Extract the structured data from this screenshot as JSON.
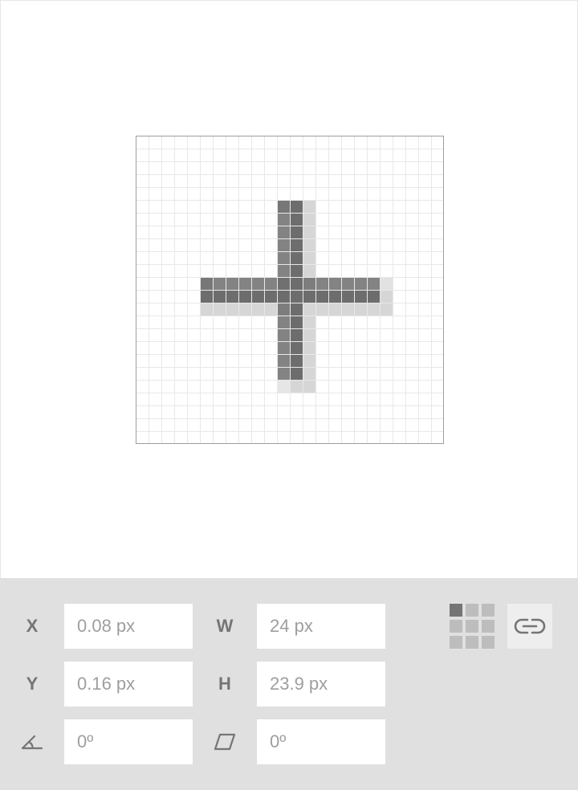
{
  "canvas": {
    "grid_cells": 24,
    "icon": "plus-icon"
  },
  "transform": {
    "x": {
      "label": "X",
      "value": "0.08 px"
    },
    "y": {
      "label": "Y",
      "value": "0.16 px"
    },
    "w": {
      "label": "W",
      "value": "24 px"
    },
    "h": {
      "label": "H",
      "value": "23.9 px"
    },
    "rotation": {
      "icon": "rotation-angle-icon",
      "value": "0º"
    },
    "skew": {
      "icon": "skew-icon",
      "value": "0º"
    }
  },
  "alignment": {
    "icon": "alignment-grid-icon",
    "active_cell": 0
  },
  "link": {
    "icon": "link-proportions-icon"
  },
  "colors": {
    "panel_bg": "#e0e0e0",
    "field_bg": "#ffffff",
    "label_text": "#757575",
    "field_text": "#9e9e9e",
    "shape_dark": "#6d6d6d",
    "shape_light": "#d6d6d6",
    "grid_line": "#e8e8e8"
  }
}
